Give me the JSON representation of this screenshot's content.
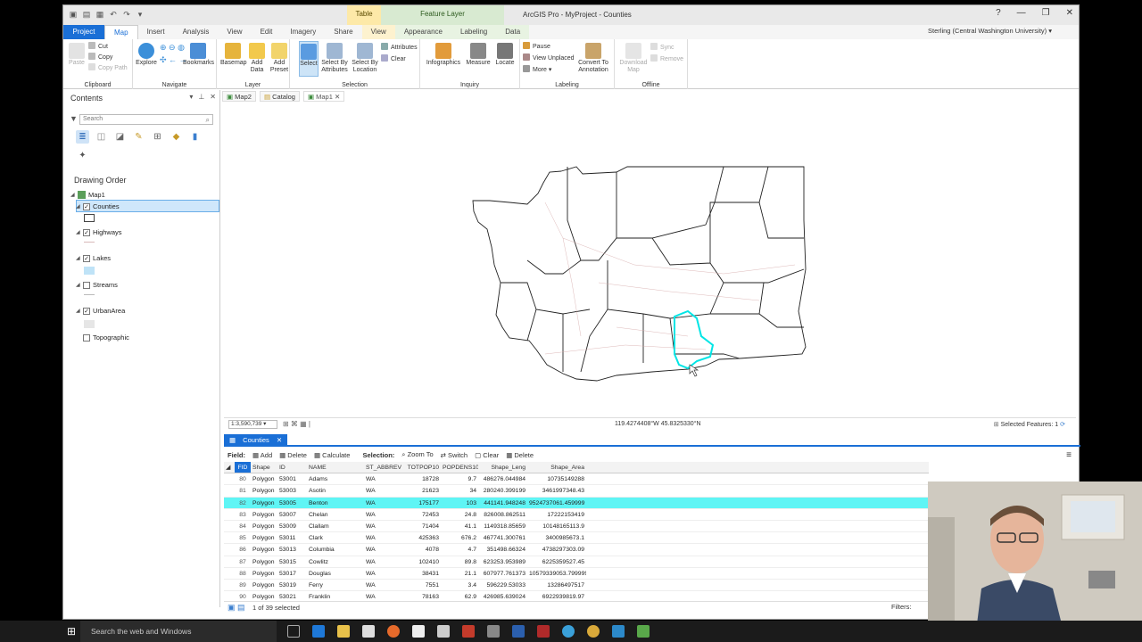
{
  "window": {
    "title": "ArcGIS Pro - MyProject - Counties",
    "contextual_table": "Table",
    "contextual_feature_layer": "Feature Layer",
    "controls": [
      "?",
      "—",
      "❐",
      "✕"
    ]
  },
  "ribbon_tabs": [
    "Project",
    "Map",
    "Insert",
    "Analysis",
    "View",
    "Edit",
    "Imagery",
    "Share",
    "View",
    "Appearance",
    "Labeling",
    "Data"
  ],
  "user": "Sterling (Central Washington University) ▾",
  "ribbon": {
    "clipboard": {
      "label": "Clipboard",
      "paste": "Paste",
      "cut": "Cut",
      "copy": "Copy",
      "copy_path": "Copy Path"
    },
    "navigate": {
      "label": "Navigate",
      "explore": "Explore",
      "bookmarks": "Bookmarks"
    },
    "layer": {
      "label": "Layer",
      "basemap": "Basemap",
      "add_data": "Add Data",
      "add_preset": "Add Preset"
    },
    "selection": {
      "label": "Selection",
      "select": "Select",
      "by_attributes": "Select By Attributes",
      "by_location": "Select By Location",
      "attributes": "Attributes",
      "clear": "Clear"
    },
    "inquiry": {
      "label": "Inquiry",
      "infographics": "Infographics",
      "measure": "Measure",
      "locate": "Locate"
    },
    "labeling": {
      "label": "Labeling",
      "pause": "Pause",
      "view_unplaced": "View Unplaced",
      "more": "More",
      "convert": "Convert To Annotation"
    },
    "offline": {
      "label": "Offline",
      "download": "Download Map",
      "sync": "Sync",
      "remove": "Remove"
    }
  },
  "contents": {
    "title": "Contents",
    "search_placeholder": "Search",
    "drawing_order": "Drawing Order",
    "map": "Map1",
    "layers": [
      {
        "name": "Counties",
        "checked": true,
        "selected": true
      },
      {
        "name": "Highways",
        "checked": true
      },
      {
        "name": "Lakes",
        "checked": true
      },
      {
        "name": "Streams",
        "checked": false
      },
      {
        "name": "UrbanArea",
        "checked": true
      },
      {
        "name": "Topographic",
        "checked": false
      }
    ]
  },
  "map_tabs": [
    "Map2",
    "Catalog",
    "Map1"
  ],
  "map_status": {
    "scale": "1:3,590,739",
    "coordinates": "119.4274408°W 45.8325330°N",
    "selected_features": "Selected Features: 1"
  },
  "table": {
    "tab": "Counties",
    "field_label": "Field:",
    "add": "Add",
    "delete": "Delete",
    "calculate": "Calculate",
    "selection_label": "Selection:",
    "zoom_to": "Zoom To",
    "switch": "Switch",
    "clear": "Clear",
    "delete2": "Delete",
    "columns": [
      "FID",
      "Shape",
      "ID",
      "NAME",
      "ST_ABBREV",
      "TOTPOP10",
      "POPDENS10",
      "Shape_Leng",
      "Shape_Area"
    ],
    "rows": [
      [
        "80",
        "Polygon",
        "53001",
        "Adams",
        "WA",
        "18728",
        "9.7",
        "486276.044984",
        "10735149288"
      ],
      [
        "81",
        "Polygon",
        "53003",
        "Asotin",
        "WA",
        "21623",
        "34",
        "280240.399199",
        "3461997348.43"
      ],
      [
        "82",
        "Polygon",
        "53005",
        "Benton",
        "WA",
        "175177",
        "103",
        "441141.948248",
        "9524737061.459999"
      ],
      [
        "83",
        "Polygon",
        "53007",
        "Chelan",
        "WA",
        "72453",
        "24.8",
        "826008.862511",
        "17222153419"
      ],
      [
        "84",
        "Polygon",
        "53009",
        "Clallam",
        "WA",
        "71404",
        "41.1",
        "1149318.85659",
        "10148165113.9"
      ],
      [
        "85",
        "Polygon",
        "53011",
        "Clark",
        "WA",
        "425363",
        "676.2",
        "467741.300761",
        "3400985673.1"
      ],
      [
        "86",
        "Polygon",
        "53013",
        "Columbia",
        "WA",
        "4078",
        "4.7",
        "351498.66324",
        "4738297303.09"
      ],
      [
        "87",
        "Polygon",
        "53015",
        "Cowlitz",
        "WA",
        "102410",
        "89.8",
        "623253.953989",
        "6225359527.45"
      ],
      [
        "88",
        "Polygon",
        "53017",
        "Douglas",
        "WA",
        "38431",
        "21.1",
        "607977.761373",
        "10579339053.799999"
      ],
      [
        "89",
        "Polygon",
        "53019",
        "Ferry",
        "WA",
        "7551",
        "3.4",
        "596229.53033",
        "13286497517"
      ],
      [
        "90",
        "Polygon",
        "53021",
        "Franklin",
        "WA",
        "78163",
        "62.9",
        "426985.639024",
        "6922939819.97"
      ]
    ],
    "highlight_index": 2,
    "footer": "1 of 39 selected",
    "filters": "Filters:"
  },
  "taskbar": {
    "search_placeholder": "Search the web and Windows"
  },
  "colors": {
    "accent": "#1a6fd6",
    "selection": "#5ff5f5",
    "county_outline": "#222222",
    "selected_county": "#00e5e5"
  }
}
